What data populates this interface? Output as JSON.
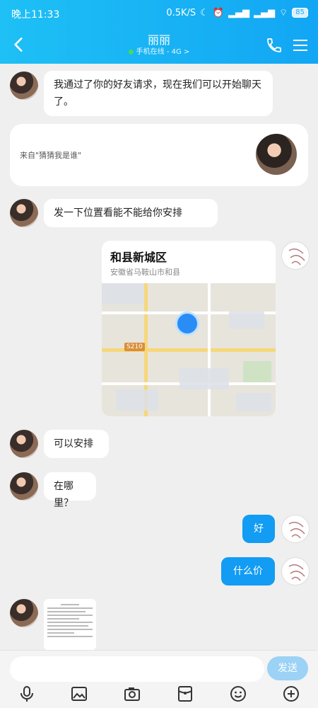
{
  "status": {
    "time": "晚上11:33",
    "speed": "0.5K/S",
    "battery": "85"
  },
  "header": {
    "title": "丽丽",
    "subtitle": "手机在线 - 4G >"
  },
  "messages": {
    "m1": "我通过了你的好友请求，现在我们可以开始聊天了。",
    "quote": "来自\"猜猜我是谁\"",
    "m2": "发一下位置看能不能给你安排",
    "location_title": "和县新城区",
    "location_sub": "安徽省马鞍山市和县",
    "map_label": "S210",
    "m3": "可以安排",
    "m4": "在哪里？",
    "me1": "好",
    "me2": "什么价"
  },
  "input": {
    "placeholder": "",
    "send": "发送"
  },
  "colors": {
    "header": "#1ec0f5",
    "my_bubble": "#129cf3",
    "send_button": "#9bd2f5"
  }
}
